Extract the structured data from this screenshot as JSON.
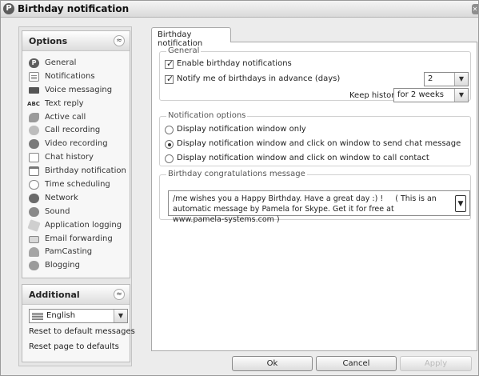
{
  "window": {
    "title": "Birthday notification"
  },
  "sidebar": {
    "options_title": "Options",
    "items": [
      {
        "label": "General",
        "icon": "p-logo-icon"
      },
      {
        "label": "Notifications",
        "icon": "document-icon"
      },
      {
        "label": "Voice messaging",
        "icon": "voicemail-icon"
      },
      {
        "label": "Text reply",
        "icon": "abc-icon"
      },
      {
        "label": "Active call",
        "icon": "phone-icon"
      },
      {
        "label": "Call recording",
        "icon": "record-icon"
      },
      {
        "label": "Video recording",
        "icon": "video-icon"
      },
      {
        "label": "Chat history",
        "icon": "chat-icon"
      },
      {
        "label": "Birthday notification",
        "icon": "calendar-icon"
      },
      {
        "label": "Time scheduling",
        "icon": "clock-icon"
      },
      {
        "label": "Network",
        "icon": "globe-icon"
      },
      {
        "label": "Sound",
        "icon": "sound-icon"
      },
      {
        "label": "Application logging",
        "icon": "log-icon"
      },
      {
        "label": "Email forwarding",
        "icon": "mail-icon"
      },
      {
        "label": "PamCasting",
        "icon": "podcast-icon"
      },
      {
        "label": "Blogging",
        "icon": "blog-icon"
      }
    ],
    "additional_title": "Additional",
    "language": "English",
    "reset_messages": "Reset to default messages",
    "reset_page": "Reset page to defaults"
  },
  "main": {
    "tab_label": "Birthday notification",
    "general": {
      "legend": "General",
      "enable_label": "Enable birthday notifications",
      "enable_checked": true,
      "advance_label": "Notify me of birthdays in advance (days)",
      "advance_checked": true,
      "advance_days": "2",
      "keep_history_label": "Keep history",
      "keep_history_value": "for 2 weeks"
    },
    "notification": {
      "legend": "Notification options",
      "options": [
        "Display notification window only",
        "Display notification window and click on window to send chat message",
        "Display notification window and click on window to call contact"
      ],
      "selected_index": 1
    },
    "congrats": {
      "legend": "Birthday congratulations message",
      "message": "/me wishes you a Happy Birthday. Have a great day :) !     ( This is an automatic message by Pamela for Skype. Get it for free at www.pamela-systems.com )"
    }
  },
  "footer": {
    "ok": "Ok",
    "cancel": "Cancel",
    "apply": "Apply"
  }
}
